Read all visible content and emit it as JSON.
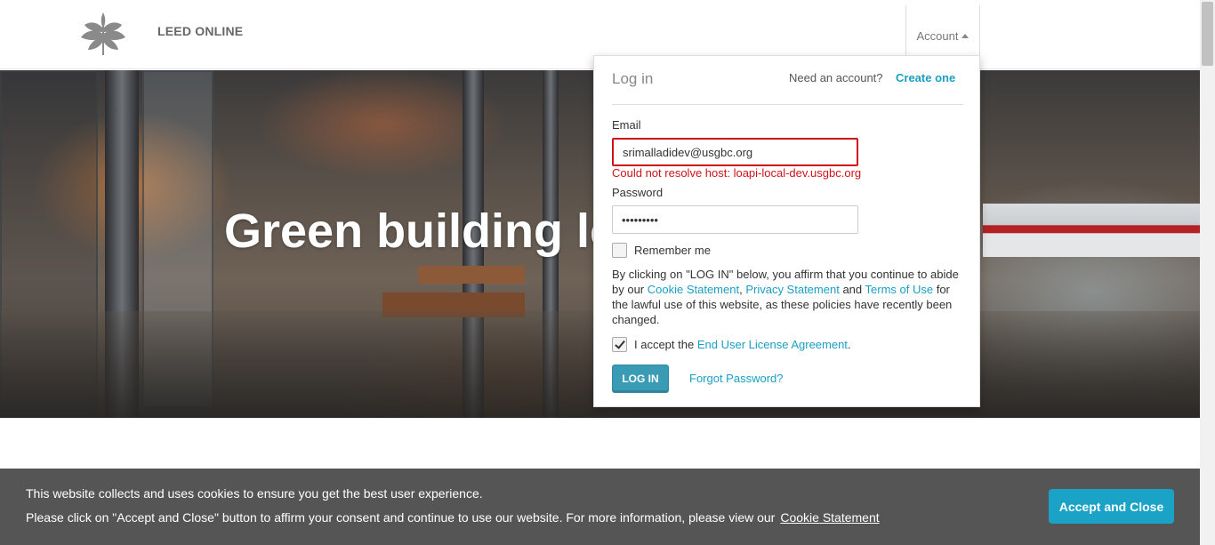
{
  "header": {
    "brand": "LEED ONLINE",
    "account_label": "Account",
    "logo_icon": "usgbc-leaf-logo-icon",
    "account_caret_icon": "caret-up-icon"
  },
  "hero": {
    "title": "Green building le"
  },
  "login": {
    "title": "Log in",
    "need_account": "Need an account?",
    "create_one": "Create one",
    "email_label": "Email",
    "email_value": "srimalladidev@usgbc.org",
    "error_message": "Could not resolve host: loapi-local-dev.usgbc.org",
    "password_label": "Password",
    "password_value": "•••••••••",
    "remember_label": "Remember me",
    "remember_checked": false,
    "terms_prefix": "By clicking on \"LOG IN\" below, you affirm that you continue to abide by our ",
    "cookie_statement": "Cookie Statement",
    "comma": ", ",
    "privacy_statement": "Privacy Statement",
    "and": " and ",
    "terms_of_use": "Terms of Use",
    "terms_suffix": " for the lawful use of this website, as these policies have recently been changed.",
    "eula_prefix": "I accept the ",
    "eula_link": "End User License Agreement",
    "eula_suffix": ".",
    "eula_checked": true,
    "login_button": "LOG IN",
    "forgot_password": "Forgot Password?",
    "link_color": "#1a9fc3",
    "error_color": "#d0121b"
  },
  "cookie_bar": {
    "line1": "This website collects and uses cookies to ensure you get the best user experience.",
    "line2": "Please click on \"Accept and Close\" button to affirm your consent and continue to use our website. For more information, please view our",
    "link": "Cookie Statement",
    "accept_button": "Accept and Close",
    "background": "#555555",
    "button_color": "#1aa3c7"
  }
}
